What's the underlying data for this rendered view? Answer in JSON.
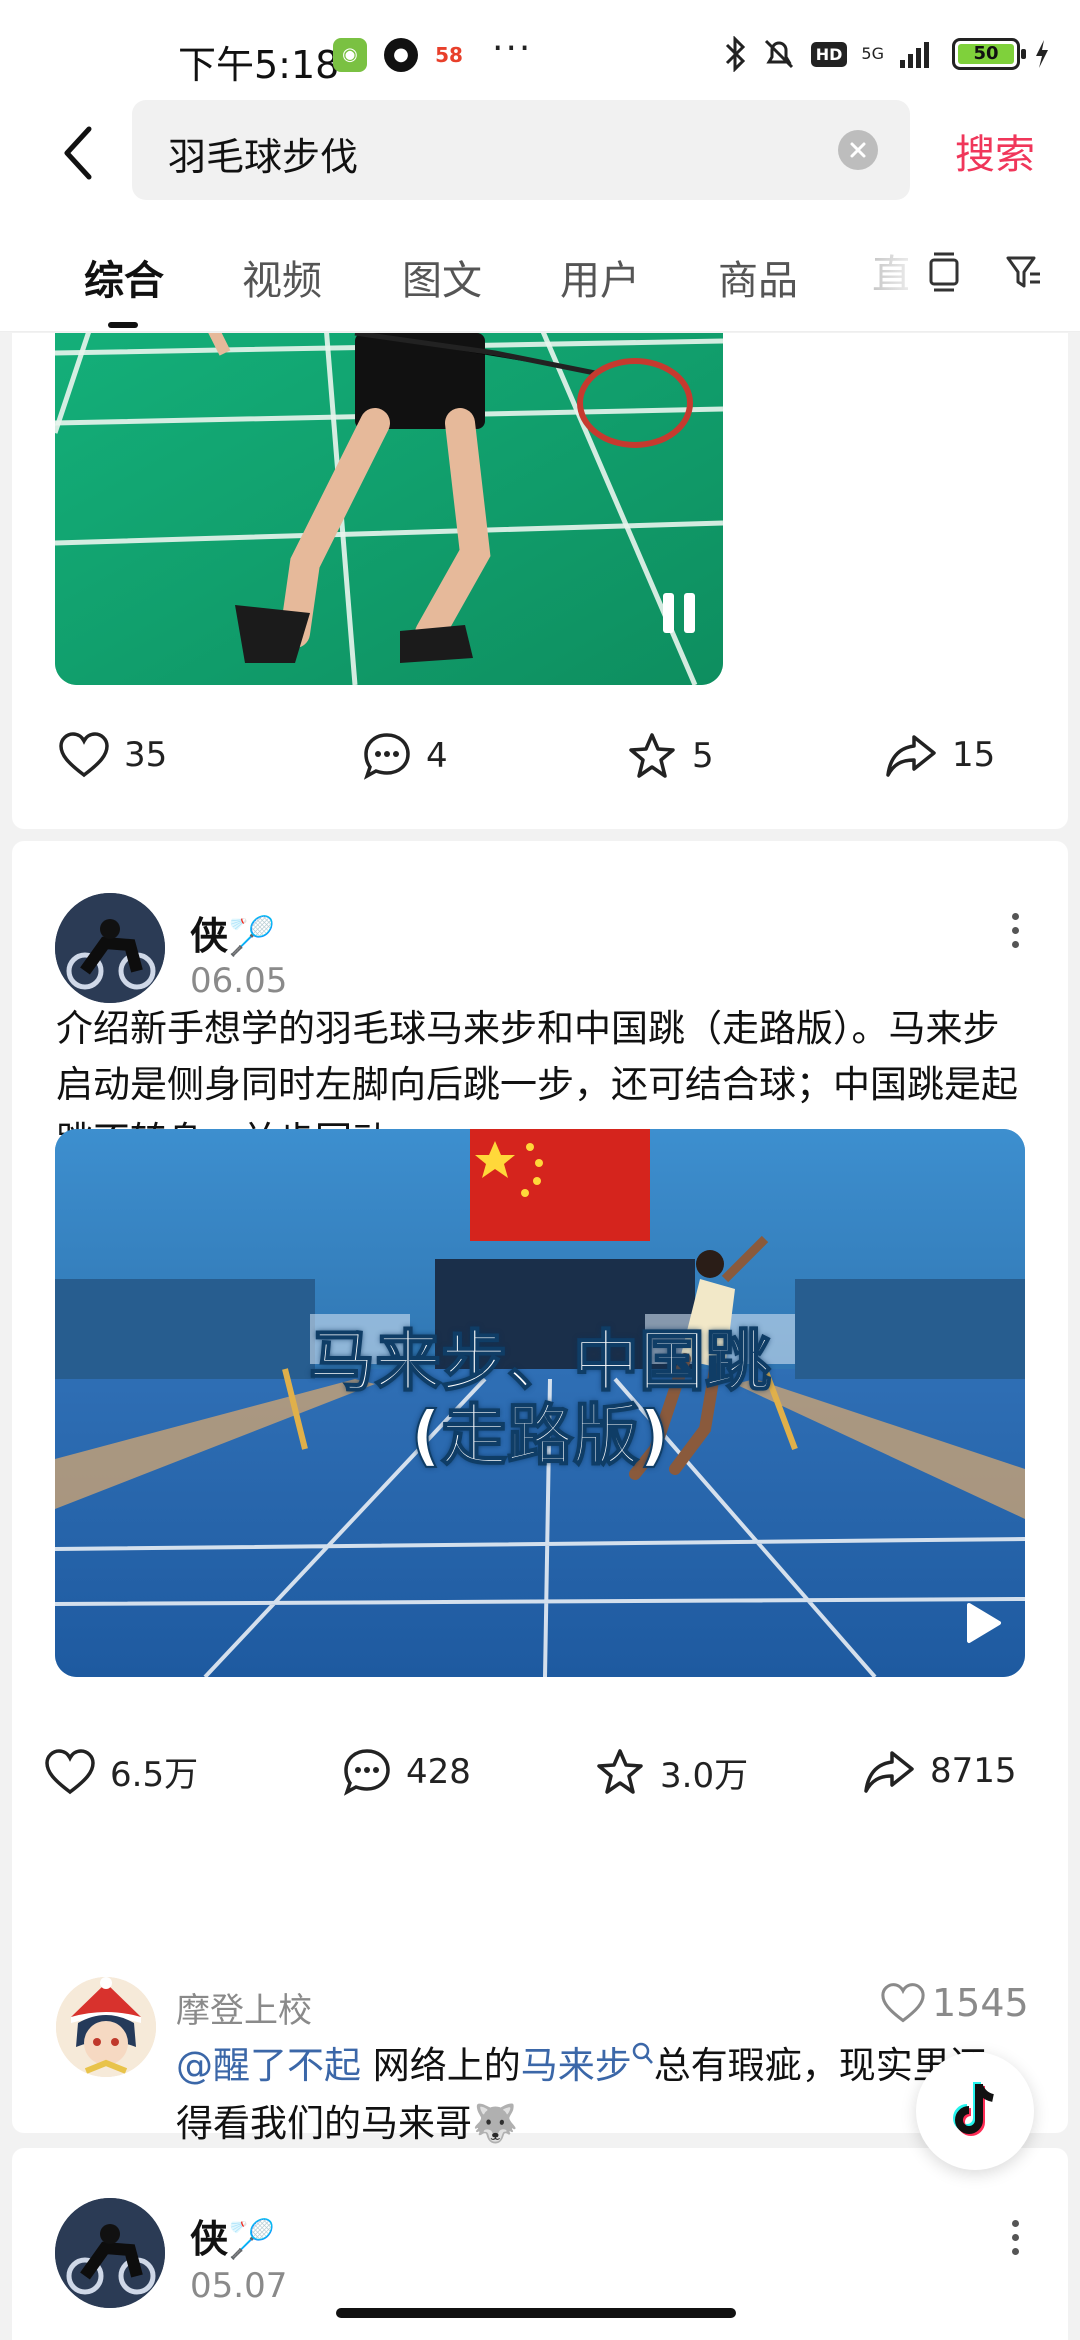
{
  "status_bar": {
    "time": "下午5:18",
    "app_58": "58",
    "more": "···",
    "hd": "HD",
    "network": "5G",
    "battery": "50"
  },
  "search": {
    "query": "羽毛球步伐",
    "submit_label": "搜索"
  },
  "tabs": [
    {
      "label": "综合",
      "active": true
    },
    {
      "label": "视频"
    },
    {
      "label": "图文"
    },
    {
      "label": "用户"
    },
    {
      "label": "商品"
    },
    {
      "label": "直"
    }
  ],
  "post1": {
    "likes": "35",
    "comments": "4",
    "favorites": "5",
    "shares": "15"
  },
  "post2": {
    "author": "侠🏸",
    "date": "06.05",
    "text": "介绍新手想学的羽毛球马来步和中国跳（走路版）。马来步启动是侧身同时左脚向后跳一步，还可结合球；中国跳是起跳不转身，并步回动。",
    "video_title_line1": "马来步、中国跳",
    "video_title_line2": "(走路版)",
    "likes": "6.5万",
    "comments": "428",
    "favorites": "3.0万",
    "shares": "8715",
    "top_comment": {
      "user": "摩登上校",
      "likes": "1545",
      "mention": "@醒了不起",
      "text_before_link": " 网络上的",
      "link": "马来步",
      "text_after_link": "总有瑕疵，现实里还得看我们的马来哥",
      "emoji": "🐺"
    }
  },
  "post3": {
    "author": "侠🏸",
    "date": "05.07"
  }
}
